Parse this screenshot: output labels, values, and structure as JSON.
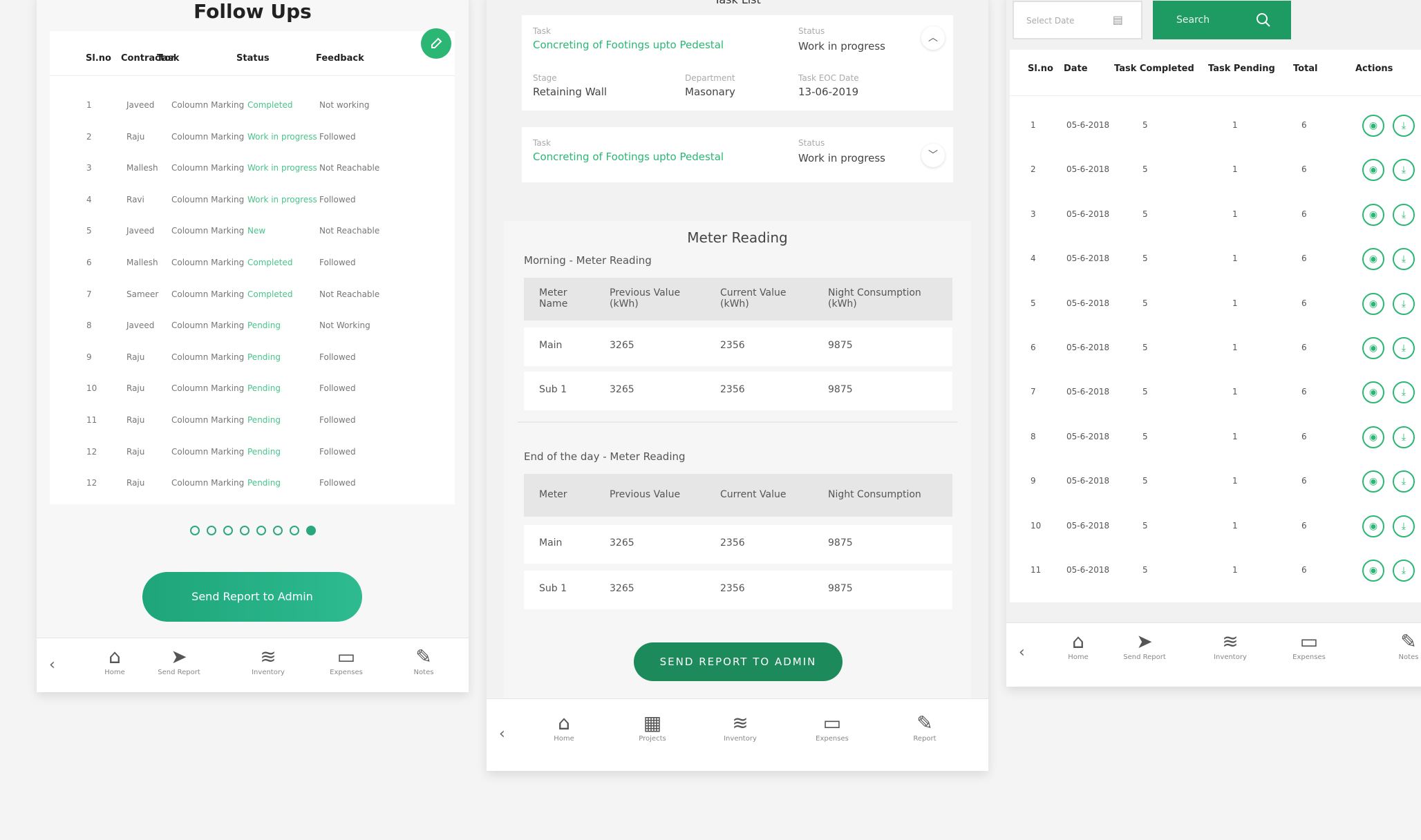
{
  "follow_ups": {
    "title": "Follow Ups",
    "headers": {
      "slno": "Sl.no",
      "contractor": "Contractor",
      "task": "Task",
      "status": "Status",
      "feedback": "Feedback"
    },
    "rows": [
      {
        "slno": "1",
        "contractor": "Javeed",
        "task": "Coloumn Marking",
        "status": "Completed",
        "feedback": "Not working"
      },
      {
        "slno": "2",
        "contractor": "Raju",
        "task": "Coloumn Marking",
        "status": "Work in progress",
        "feedback": "Followed"
      },
      {
        "slno": "3",
        "contractor": "Mallesh",
        "task": "Coloumn Marking",
        "status": "Work in progress",
        "feedback": "Not Reachable"
      },
      {
        "slno": "4",
        "contractor": "Ravi",
        "task": "Coloumn Marking",
        "status": "Work in progress",
        "feedback": "Followed"
      },
      {
        "slno": "5",
        "contractor": "Javeed",
        "task": "Coloumn Marking",
        "status": "New",
        "feedback": "Not Reachable"
      },
      {
        "slno": "6",
        "contractor": "Mallesh",
        "task": "Coloumn Marking",
        "status": "Completed",
        "feedback": "Followed"
      },
      {
        "slno": "7",
        "contractor": "Sameer",
        "task": "Coloumn Marking",
        "status": "Completed",
        "feedback": "Not Reachable"
      },
      {
        "slno": "8",
        "contractor": "Javeed",
        "task": "Coloumn Marking",
        "status": "Pending",
        "feedback": "Not Working"
      },
      {
        "slno": "9",
        "contractor": "Raju",
        "task": "Coloumn Marking",
        "status": "Pending",
        "feedback": "Followed"
      },
      {
        "slno": "10",
        "contractor": "Raju",
        "task": "Coloumn Marking",
        "status": "Pending",
        "feedback": "Followed"
      },
      {
        "slno": "11",
        "contractor": "Raju",
        "task": "Coloumn Marking",
        "status": "Pending",
        "feedback": "Followed"
      },
      {
        "slno": "12",
        "contractor": "Raju",
        "task": "Coloumn Marking",
        "status": "Pending",
        "feedback": "Followed"
      },
      {
        "slno": "12",
        "contractor": "Raju",
        "task": "Coloumn Marking",
        "status": "Pending",
        "feedback": "Followed"
      }
    ],
    "pagination": {
      "total": 8,
      "active_index": 7
    },
    "send_button": "Send Report to Admin",
    "nav": [
      {
        "label": "Home",
        "icon": "home-icon",
        "glyph": "⌂"
      },
      {
        "label": "Send Report",
        "icon": "send-icon",
        "glyph": "➤"
      },
      {
        "label": "Inventory",
        "icon": "layers-icon",
        "glyph": "≋"
      },
      {
        "label": "Expenses",
        "icon": "cash-icon",
        "glyph": "▭"
      },
      {
        "label": "Notes",
        "icon": "notes-icon",
        "glyph": "✎"
      }
    ]
  },
  "task_panel": {
    "title": "Task List",
    "tasks": [
      {
        "task_label": "Task",
        "task_value": "Concreting of Footings upto Pedestal",
        "status_label": "Status",
        "status_value": "Work in progress",
        "stage_label": "Stage",
        "stage_value": "Retaining Wall",
        "dept_label": "Department",
        "dept_value": "Masonary",
        "date_label": "Task EOC Date",
        "date_value": "13-06-2019",
        "expanded": true
      },
      {
        "task_label": "Task",
        "task_value": "Concreting of Footings upto Pedestal",
        "status_label": "Status",
        "status_value": "Work in progress",
        "expanded": false
      }
    ],
    "meter": {
      "title": "Meter Reading",
      "morning_title": "Morning - Meter Reading",
      "morning_headers": [
        "Meter Name",
        "Previous Value (kWh)",
        "Current Value (kWh)",
        "Night Consumption (kWh)"
      ],
      "morning_rows": [
        [
          "Main",
          "3265",
          "2356",
          "9875"
        ],
        [
          "Sub 1",
          "3265",
          "2356",
          "9875"
        ]
      ],
      "eod_title": "End of the day - Meter Reading",
      "eod_headers": [
        "Meter",
        "Previous Value",
        "Current Value",
        "Night Consumption"
      ],
      "eod_rows": [
        [
          "Main",
          "3265",
          "2356",
          "9875"
        ],
        [
          "Sub 1",
          "3265",
          "2356",
          "9875"
        ]
      ]
    },
    "send_button": "SEND REPORT TO ADMIN",
    "nav": [
      {
        "label": "Home",
        "icon": "home-icon",
        "glyph": "⌂"
      },
      {
        "label": "Projects",
        "icon": "projects-icon",
        "glyph": "▦"
      },
      {
        "label": "Inventory",
        "icon": "layers-icon",
        "glyph": "≋"
      },
      {
        "label": "Expenses",
        "icon": "cash-icon",
        "glyph": "▭"
      },
      {
        "label": "Report",
        "icon": "report-icon",
        "glyph": "✎"
      }
    ]
  },
  "report_panel": {
    "date_placeholder": "Select Date",
    "search_label": "Search",
    "headers": {
      "slno": "Sl.no",
      "date": "Date",
      "completed": "Task Completed",
      "pending": "Task Pending",
      "total": "Total",
      "actions": "Actions"
    },
    "rows": [
      {
        "slno": "1",
        "date": "05-6-2018",
        "completed": "5",
        "pending": "1",
        "total": "6"
      },
      {
        "slno": "2",
        "date": "05-6-2018",
        "completed": "5",
        "pending": "1",
        "total": "6"
      },
      {
        "slno": "3",
        "date": "05-6-2018",
        "completed": "5",
        "pending": "1",
        "total": "6"
      },
      {
        "slno": "4",
        "date": "05-6-2018",
        "completed": "5",
        "pending": "1",
        "total": "6"
      },
      {
        "slno": "5",
        "date": "05-6-2018",
        "completed": "5",
        "pending": "1",
        "total": "6"
      },
      {
        "slno": "6",
        "date": "05-6-2018",
        "completed": "5",
        "pending": "1",
        "total": "6"
      },
      {
        "slno": "7",
        "date": "05-6-2018",
        "completed": "5",
        "pending": "1",
        "total": "6"
      },
      {
        "slno": "8",
        "date": "05-6-2018",
        "completed": "5",
        "pending": "1",
        "total": "6"
      },
      {
        "slno": "9",
        "date": "05-6-2018",
        "completed": "5",
        "pending": "1",
        "total": "6"
      },
      {
        "slno": "10",
        "date": "05-6-2018",
        "completed": "5",
        "pending": "1",
        "total": "6"
      },
      {
        "slno": "11",
        "date": "05-6-2018",
        "completed": "5",
        "pending": "1",
        "total": "6"
      }
    ],
    "nav": [
      {
        "label": "Home",
        "icon": "home-icon",
        "glyph": "⌂"
      },
      {
        "label": "Send Report",
        "icon": "send-icon",
        "glyph": "➤"
      },
      {
        "label": "Inventory",
        "icon": "layers-icon",
        "glyph": "≋"
      },
      {
        "label": "Expenses",
        "icon": "cash-icon",
        "glyph": "▭"
      },
      {
        "label": "Notes",
        "icon": "notes-icon",
        "glyph": "✎"
      }
    ]
  },
  "colors": {
    "accent": "#2bb673",
    "dark_accent": "#1c8a5a"
  }
}
